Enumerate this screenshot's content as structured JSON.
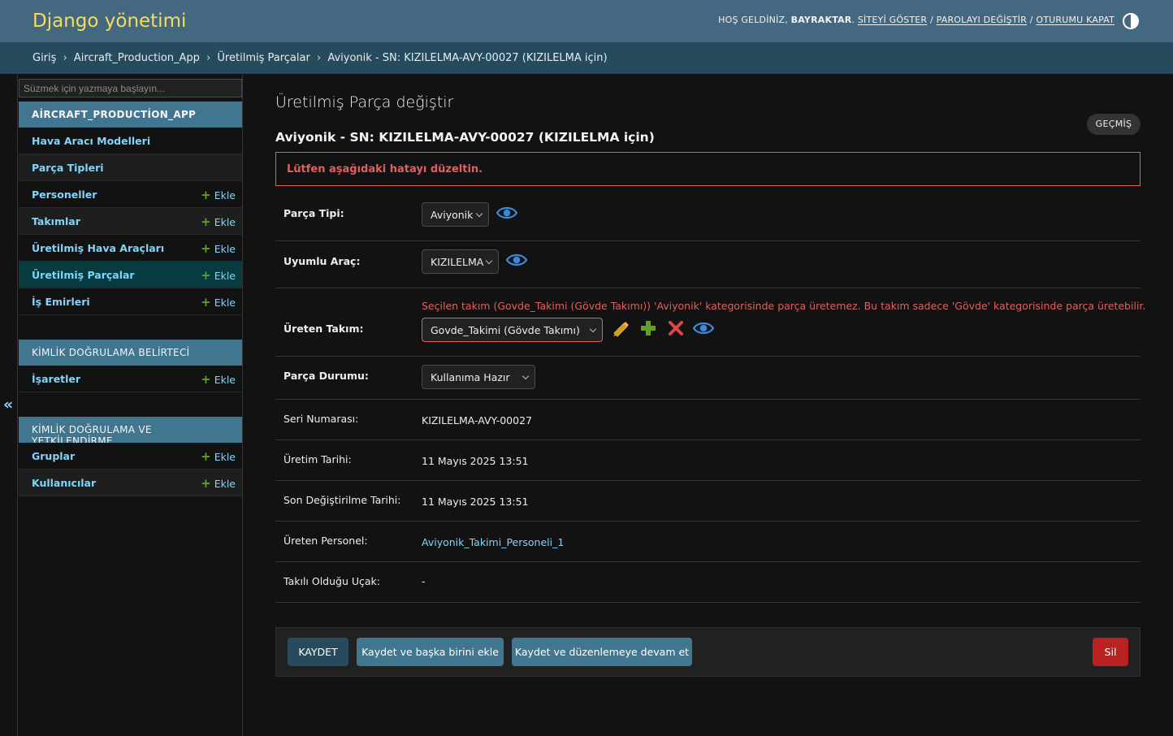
{
  "header": {
    "branding": "Django yönetimi",
    "welcome": "HOŞ GELDİNİZ,",
    "username": "BAYRAKTAR",
    "view_site": "SİTEYİ GÖSTER",
    "change_password": "PAROLAYI DEĞİŞTİR",
    "logout": "OTURUMU KAPAT",
    "separator": "/",
    "theme_toggle_icon": "half-circle-contrast-icon"
  },
  "breadcrumbs": {
    "items": [
      "Giriş",
      "Aircraft_Production_App",
      "Üretilmiş Parçalar"
    ],
    "current": "Aviyonik - SN: KIZILELMA-AVY-00027 (KIZILELMA için)",
    "separator": "›"
  },
  "sidebar": {
    "filter_placeholder": "Süzmek için yazmaya başlayın...",
    "collapse_icon": "«",
    "add_label": "Ekle",
    "modules": [
      {
        "caption": "AİRCRAFT_PRODUCTİON_APP",
        "models": [
          {
            "label": "Hava Aracı Modelleri",
            "add": false
          },
          {
            "label": "Parça Tipleri",
            "add": false
          },
          {
            "label": "Personeller",
            "add": true
          },
          {
            "label": "Takımlar",
            "add": true
          },
          {
            "label": "Üretilmiş Hava Araçları",
            "add": true
          },
          {
            "label": "Üretilmiş Parçalar",
            "add": true,
            "current": true
          },
          {
            "label": "İş Emirleri",
            "add": true
          }
        ]
      },
      {
        "caption": "KİMLİK DOĞRULAMA BELİRTECİ",
        "models": [
          {
            "label": "İşaretler",
            "add": true
          }
        ]
      },
      {
        "caption": "KİMLİK DOĞRULAMA VE YETKİLENDİRME",
        "models": [
          {
            "label": "Gruplar",
            "add": true
          },
          {
            "label": "Kullanıcılar",
            "add": true
          }
        ]
      }
    ]
  },
  "content": {
    "title": "Üretilmiş Parça değiştir",
    "subtitle": "Aviyonik - SN: KIZILELMA-AVY-00027 (KIZILELMA için)",
    "history_button": "GEÇMİŞ",
    "error_note": "Lütfen aşağıdaki hatayı düzeltin.",
    "fields": {
      "parca_tipi": {
        "label": "Parça Tipi:",
        "value": "Aviyonik"
      },
      "uyumlu_arac": {
        "label": "Uyumlu Araç:",
        "value": "KIZILELMA"
      },
      "ureten_takim": {
        "label": "Üreten Takım:",
        "value": "Govde_Takimi (Gövde Takımı)",
        "error": "Seçilen takım (Govde_Takimi (Gövde Takımı)) 'Aviyonik' kategorisinde parça üretemez. Bu takım sadece 'Gövde' kategorisinde parça üretebilir."
      },
      "parca_durumu": {
        "label": "Parça Durumu:",
        "value": "Kullanıma Hazır"
      },
      "seri_numarasi": {
        "label": "Seri Numarası:",
        "value": "KIZILELMA-AVY-00027"
      },
      "uretim_tarihi": {
        "label": "Üretim Tarihi:",
        "value": "11 Mayıs 2025 13:51"
      },
      "son_degistirilme": {
        "label": "Son Değiştirilme Tarihi:",
        "value": "11 Mayıs 2025 13:51"
      },
      "ureten_personel": {
        "label": "Üreten Personel:",
        "value": "Aviyonik_Takimi_Personeli_1"
      },
      "takili_oldugu_ucak": {
        "label": "Takılı Olduğu Uçak:",
        "value": "-"
      }
    },
    "icons": {
      "view": "eye-icon",
      "change": "pencil-icon",
      "add": "plus-icon",
      "delete": "x-icon"
    }
  },
  "submit_row": {
    "save": "KAYDET",
    "save_add_another": "Kaydet ve başka birini ekle",
    "save_continue": "Kaydet ve düzenlemeye devam et",
    "delete": "Sil"
  },
  "colors": {
    "header_bg": "#44687f",
    "branding": "#f5dd5d",
    "breadcrumbs_bg": "#264b5d",
    "module_caption_bg": "#417690",
    "link": "#81d4fa",
    "error": "#e35f5f",
    "add_green": "#5fa225",
    "delete_red": "#ba2121",
    "current_row_bg": "#073b3f"
  }
}
